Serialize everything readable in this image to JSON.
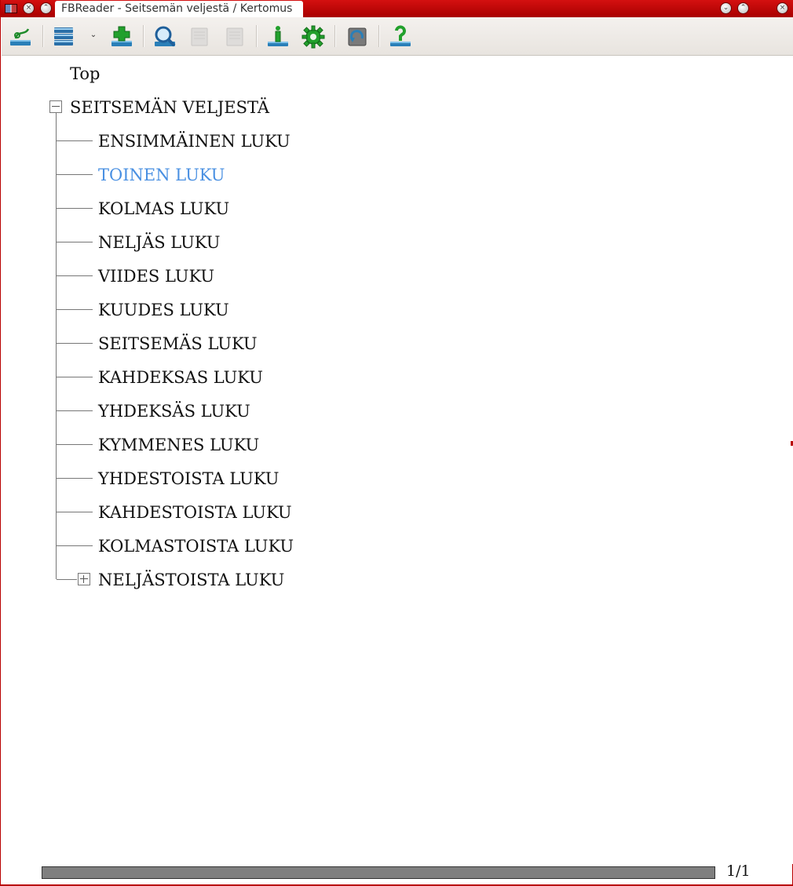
{
  "window": {
    "title": "FBReader - Seitsemän veljestä / Kertomus",
    "accent_color": "#c00000"
  },
  "titlebar": {
    "menu_icon": "app-menu-icon",
    "close_symbol": "×",
    "minimize_symbol": "⌄",
    "maximize_symbol": "⌃"
  },
  "toolbar": {
    "buttons": [
      {
        "name": "library-icon"
      },
      {
        "name": "recent-books-icon"
      },
      {
        "name": "add-book-icon"
      },
      {
        "name": "search-icon"
      },
      {
        "name": "undo-icon"
      },
      {
        "name": "redo-icon"
      },
      {
        "name": "book-info-icon"
      },
      {
        "name": "preferences-icon"
      },
      {
        "name": "rotate-icon"
      },
      {
        "name": "help-icon"
      }
    ]
  },
  "toc": {
    "top_label": "Top",
    "root": {
      "label": "SEITSEMÄN VELJESTÄ",
      "expanded": true,
      "children": [
        {
          "label": "ENSIMMÄINEN LUKU"
        },
        {
          "label": "TOINEN LUKU",
          "selected": true
        },
        {
          "label": "KOLMAS LUKU"
        },
        {
          "label": "NELJÄS LUKU"
        },
        {
          "label": "VIIDES LUKU"
        },
        {
          "label": "KUUDES LUKU"
        },
        {
          "label": "SEITSEMÄS LUKU"
        },
        {
          "label": "KAHDEKSAS LUKU"
        },
        {
          "label": "YHDEKSÄS LUKU"
        },
        {
          "label": "KYMMENES LUKU"
        },
        {
          "label": "YHDESTOISTA LUKU"
        },
        {
          "label": "KAHDESTOISTA LUKU"
        },
        {
          "label": "KOLMASTOISTA LUKU"
        },
        {
          "label": "NELJÄSTOISTA LUKU",
          "collapsed": true
        }
      ]
    },
    "selected_color": "#4a90e2"
  },
  "footer": {
    "page_indicator": "1/1",
    "progress_fraction": 1.0
  }
}
